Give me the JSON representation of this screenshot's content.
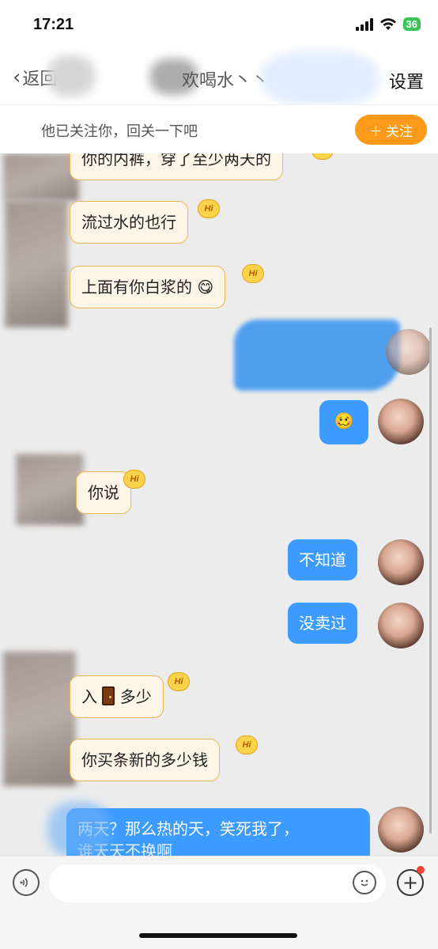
{
  "status_bar": {
    "time": "17:21",
    "battery": "36"
  },
  "nav": {
    "back_label": "返回",
    "title": "欢喝水丶丶",
    "settings_label": "设置"
  },
  "follow_bar": {
    "text": "他已关注你，回关一下吧",
    "button_label": "关注",
    "button_icon": "plus-icon"
  },
  "messages": [
    {
      "side": "in",
      "text": "你的内裤，穿了至少两天的",
      "badge": "Hi"
    },
    {
      "side": "in",
      "text": "流过水的也行",
      "badge": "Hi"
    },
    {
      "side": "in",
      "text": "上面有你白浆的",
      "emoji": "😋",
      "badge": "Hi"
    },
    {
      "side": "out",
      "text": "",
      "emoji": "🥴"
    },
    {
      "side": "in",
      "text": "你说",
      "badge": "Hi"
    },
    {
      "side": "out",
      "text": "不知道"
    },
    {
      "side": "out",
      "text": "没卖过"
    },
    {
      "side": "in",
      "text_before": "入",
      "icon": "door-icon",
      "text_after": "多少",
      "badge": "Hi"
    },
    {
      "side": "in",
      "text": "你买条新的多少钱",
      "badge": "Hi"
    },
    {
      "side": "out",
      "text": "两天？那么热的天，笑死我了，",
      "text2": "谁天天不换啊"
    }
  ],
  "input_bar": {
    "voice_icon": "voice-icon",
    "emoji_icon": "emoji-icon",
    "plus_icon": "plus-icon"
  }
}
